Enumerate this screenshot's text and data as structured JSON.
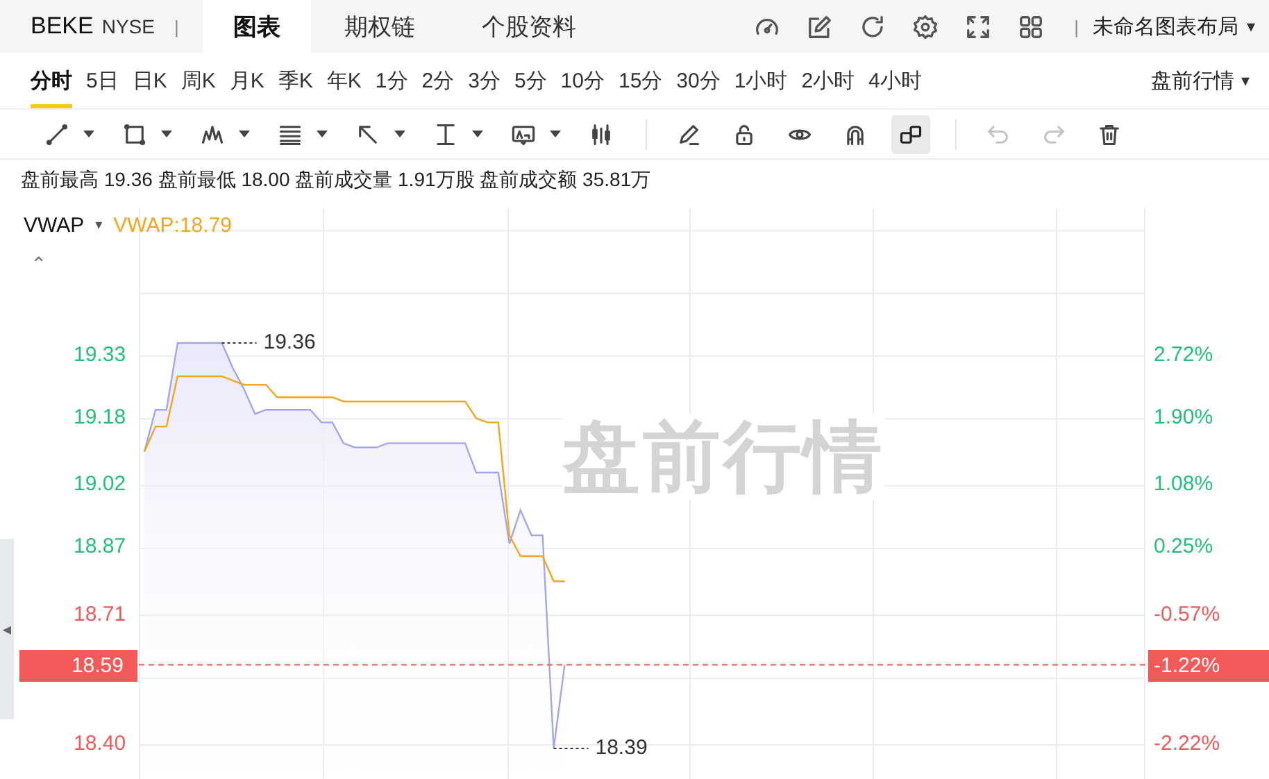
{
  "header": {
    "symbol": "BEKE",
    "exchange": "NYSE",
    "separator": "|",
    "tabs": [
      {
        "label": "图表",
        "selected": true
      },
      {
        "label": "期权链",
        "selected": false
      },
      {
        "label": "个股资料",
        "selected": false
      }
    ],
    "layout_separator": "|",
    "layout_menu": "未命名图表布局",
    "layout_caret": "▾"
  },
  "periods": {
    "items": [
      {
        "label": "分时",
        "selected": true
      },
      {
        "label": "5日",
        "selected": false
      },
      {
        "label": "日K",
        "selected": false
      },
      {
        "label": "周K",
        "selected": false
      },
      {
        "label": "月K",
        "selected": false
      },
      {
        "label": "季K",
        "selected": false
      },
      {
        "label": "年K",
        "selected": false
      },
      {
        "label": "1分",
        "selected": false
      },
      {
        "label": "2分",
        "selected": false
      },
      {
        "label": "3分",
        "selected": false
      },
      {
        "label": "5分",
        "selected": false
      },
      {
        "label": "10分",
        "selected": false
      },
      {
        "label": "15分",
        "selected": false
      },
      {
        "label": "30分",
        "selected": false
      },
      {
        "label": "1小时",
        "selected": false
      },
      {
        "label": "2小时",
        "selected": false
      },
      {
        "label": "4小时",
        "selected": false
      }
    ],
    "session_menu": "盘前行情",
    "session_caret": "▾"
  },
  "toolbar": [
    {
      "kind": "line",
      "dropdown": true,
      "selected": false,
      "disabled": false
    },
    {
      "kind": "rect",
      "dropdown": true,
      "selected": false,
      "disabled": false
    },
    {
      "kind": "pattern",
      "dropdown": true,
      "selected": false,
      "disabled": false
    },
    {
      "kind": "fib",
      "dropdown": true,
      "selected": false,
      "disabled": false
    },
    {
      "kind": "arrow",
      "dropdown": true,
      "selected": false,
      "disabled": false
    },
    {
      "kind": "measure",
      "dropdown": true,
      "selected": false,
      "disabled": false
    },
    {
      "kind": "textbox",
      "dropdown": true,
      "selected": false,
      "disabled": false
    },
    {
      "kind": "candles",
      "dropdown": false,
      "selected": false,
      "disabled": false
    },
    {
      "kind": "divider"
    },
    {
      "kind": "pencil",
      "dropdown": false,
      "selected": false,
      "disabled": false
    },
    {
      "kind": "lock",
      "dropdown": false,
      "selected": false,
      "disabled": false
    },
    {
      "kind": "eye",
      "dropdown": false,
      "selected": false,
      "disabled": false
    },
    {
      "kind": "magnet",
      "dropdown": false,
      "selected": false,
      "disabled": false
    },
    {
      "kind": "squares",
      "dropdown": false,
      "selected": true,
      "disabled": false
    },
    {
      "kind": "divider"
    },
    {
      "kind": "undo",
      "dropdown": false,
      "selected": false,
      "disabled": true
    },
    {
      "kind": "redo",
      "dropdown": false,
      "selected": false,
      "disabled": true
    },
    {
      "kind": "trash",
      "dropdown": false,
      "selected": false,
      "disabled": false
    }
  ],
  "stats": "盘前最高 19.36 盘前最低 18.00 盘前成交量 1.91万股 盘前成交额 35.81万",
  "chart": {
    "indicator": "VWAP",
    "indicator_caret": "▾",
    "indicator_value": "VWAP:18.79",
    "collapse": "⌃",
    "side_handle": "◀",
    "background_label": "盘前行情",
    "right_ticks": [
      {
        "label": "2.72%",
        "color": "#22c07a"
      },
      {
        "label": "1.90%",
        "color": "#22c07a"
      },
      {
        "label": "1.08%",
        "color": "#22c07a"
      },
      {
        "label": "0.25%",
        "color": "#22c07a"
      },
      {
        "label": "-0.57%",
        "color": "#f05a5a"
      },
      {
        "label": "-2.22%",
        "color": "#f05a5a"
      }
    ],
    "change_badge": "-1.22%",
    "chart_data": {
      "type": "line",
      "grid": true,
      "categories": [
        null,
        null,
        null,
        null,
        null,
        null,
        null,
        null,
        null,
        null,
        null,
        null,
        null,
        null,
        null,
        null,
        null,
        null,
        null,
        null,
        null,
        null,
        null,
        null,
        null,
        null,
        null,
        null,
        null,
        null,
        null,
        null,
        null,
        null,
        null,
        null,
        null,
        null,
        null,
        null,
        null,
        null,
        null,
        null,
        null,
        null,
        null,
        null,
        null,
        null,
        null,
        null,
        null,
        null,
        null,
        null,
        null,
        null,
        null,
        null,
        null,
        null,
        null,
        null,
        null,
        null,
        null,
        null,
        null,
        null,
        null,
        null,
        null,
        null,
        null,
        null,
        null,
        null,
        null,
        null,
        null,
        null,
        null,
        null,
        null,
        null,
        null,
        null,
        null,
        null,
        null
      ],
      "series": [
        {
          "color": "#a3a6ee",
          "values": [
            19.1,
            19.2,
            19.2,
            19.36,
            19.36,
            19.36,
            19.36,
            19.36,
            19.3,
            19.25,
            19.19,
            19.2,
            19.2,
            19.2,
            19.2,
            19.2,
            19.17,
            19.17,
            19.12,
            19.11,
            19.11,
            19.11,
            19.12,
            19.12,
            19.12,
            19.12,
            19.12,
            19.12,
            19.12,
            19.12,
            19.05,
            19.05,
            19.05,
            18.88,
            18.96,
            18.9,
            18.9,
            18.39,
            18.59,
            null,
            null,
            null,
            null,
            null,
            null,
            null,
            null,
            null,
            null,
            null,
            null,
            null,
            null,
            null,
            null,
            null,
            null,
            null,
            null,
            null,
            null,
            null,
            null,
            null,
            null,
            null,
            null,
            null,
            null,
            null,
            null,
            null,
            null,
            null,
            null,
            null,
            null,
            null,
            null,
            null,
            null,
            null,
            null,
            null,
            null,
            null,
            null,
            null,
            null,
            null,
            null
          ]
        },
        {
          "color": "#f7a51c",
          "values": [
            19.1,
            19.16,
            19.16,
            19.28,
            19.28,
            19.28,
            19.28,
            19.28,
            19.27,
            19.26,
            19.26,
            19.26,
            19.23,
            19.23,
            19.23,
            19.23,
            19.23,
            19.23,
            19.22,
            19.22,
            19.22,
            19.22,
            19.22,
            19.22,
            19.22,
            19.22,
            19.22,
            19.22,
            19.22,
            19.22,
            19.18,
            19.17,
            19.17,
            18.9,
            18.85,
            18.85,
            18.85,
            18.79,
            18.79,
            null,
            null,
            null,
            null,
            null,
            null,
            null,
            null,
            null,
            null,
            null,
            null,
            null,
            null,
            null,
            null,
            null,
            null,
            null,
            null,
            null,
            null,
            null,
            null,
            null,
            null,
            null,
            null,
            null,
            null,
            null,
            null,
            null,
            null,
            null,
            null,
            null,
            null,
            null,
            null,
            null,
            null,
            null,
            null,
            null,
            null,
            null,
            null,
            null,
            null,
            null,
            null
          ]
        }
      ],
      "ylim": [
        18.317,
        19.682
      ],
      "yticks": [
        {
          "value": 19.33,
          "label": "19.33"
        },
        {
          "value": 19.18,
          "label": "19.18"
        },
        {
          "value": 19.02,
          "label": "19.02"
        },
        {
          "value": 18.87,
          "label": "18.87"
        },
        {
          "value": 18.71,
          "label": "18.71"
        },
        {
          "value": 18.4,
          "label": "18.40"
        }
      ],
      "ref_lines": [
        {
          "axis": "y",
          "value": 18.59,
          "label": "18.59"
        }
      ],
      "annotations": [
        "19.36",
        "18.39"
      ]
    }
  }
}
